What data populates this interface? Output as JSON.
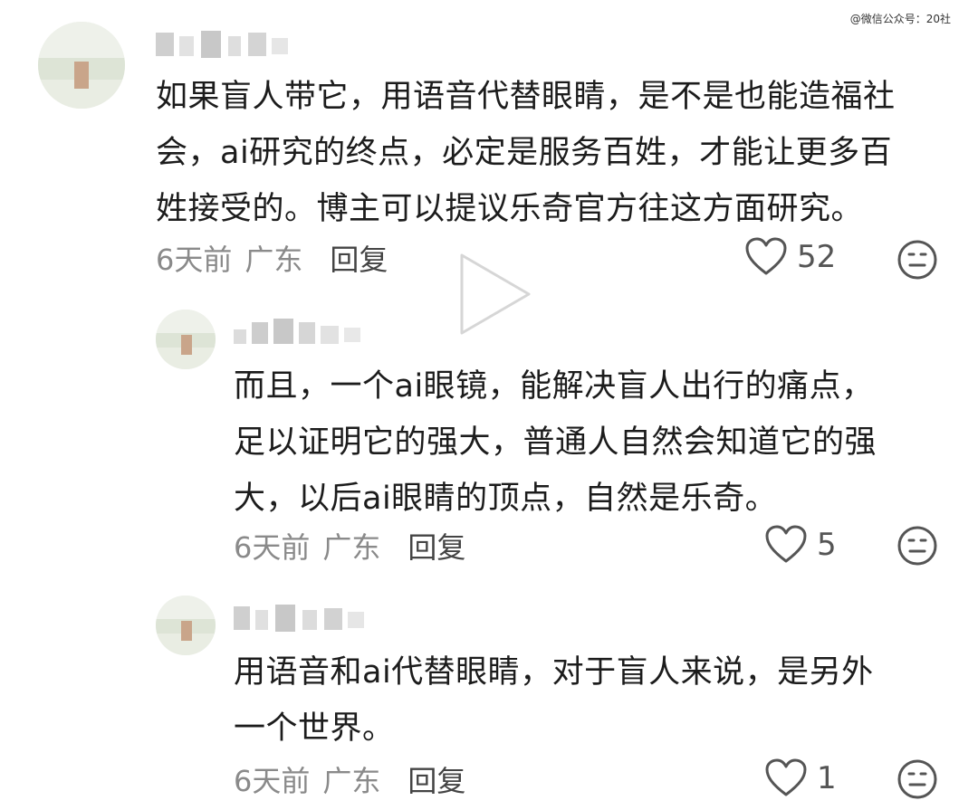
{
  "watermark": "@微信公众号：20社",
  "comments": [
    {
      "text_lines": [
        "如果盲人带它，用语音代替眼睛，是不是也能造福社",
        "会，ai研究的终点，必定是服务百姓，才能让更多百",
        "姓接受的。博主可以提议乐奇官方往这方面研究。"
      ],
      "time": "6天前",
      "location": "广东",
      "reply_label": "回复",
      "likes": "52"
    },
    {
      "text_lines": [
        "而且，一个ai眼镜，能解决盲人出行的痛点，",
        "足以证明它的强大，普通人自然会知道它的强",
        "大，以后ai眼睛的顶点，自然是乐奇。"
      ],
      "time": "6天前",
      "location": "广东",
      "reply_label": "回复",
      "likes": "5"
    },
    {
      "text_lines": [
        "用语音和ai代替眼睛，对于盲人来说，是另外",
        "一个世界。"
      ],
      "time": "6天前",
      "location": "广东",
      "reply_label": "回复",
      "likes": "1"
    }
  ],
  "icons": {
    "like": "heart-outline-icon",
    "dislike": "neutral-face-icon",
    "video": "play-icon"
  },
  "colors": {
    "text": "#1c1c1c",
    "meta": "#8a8a8a",
    "icon": "#555555"
  }
}
